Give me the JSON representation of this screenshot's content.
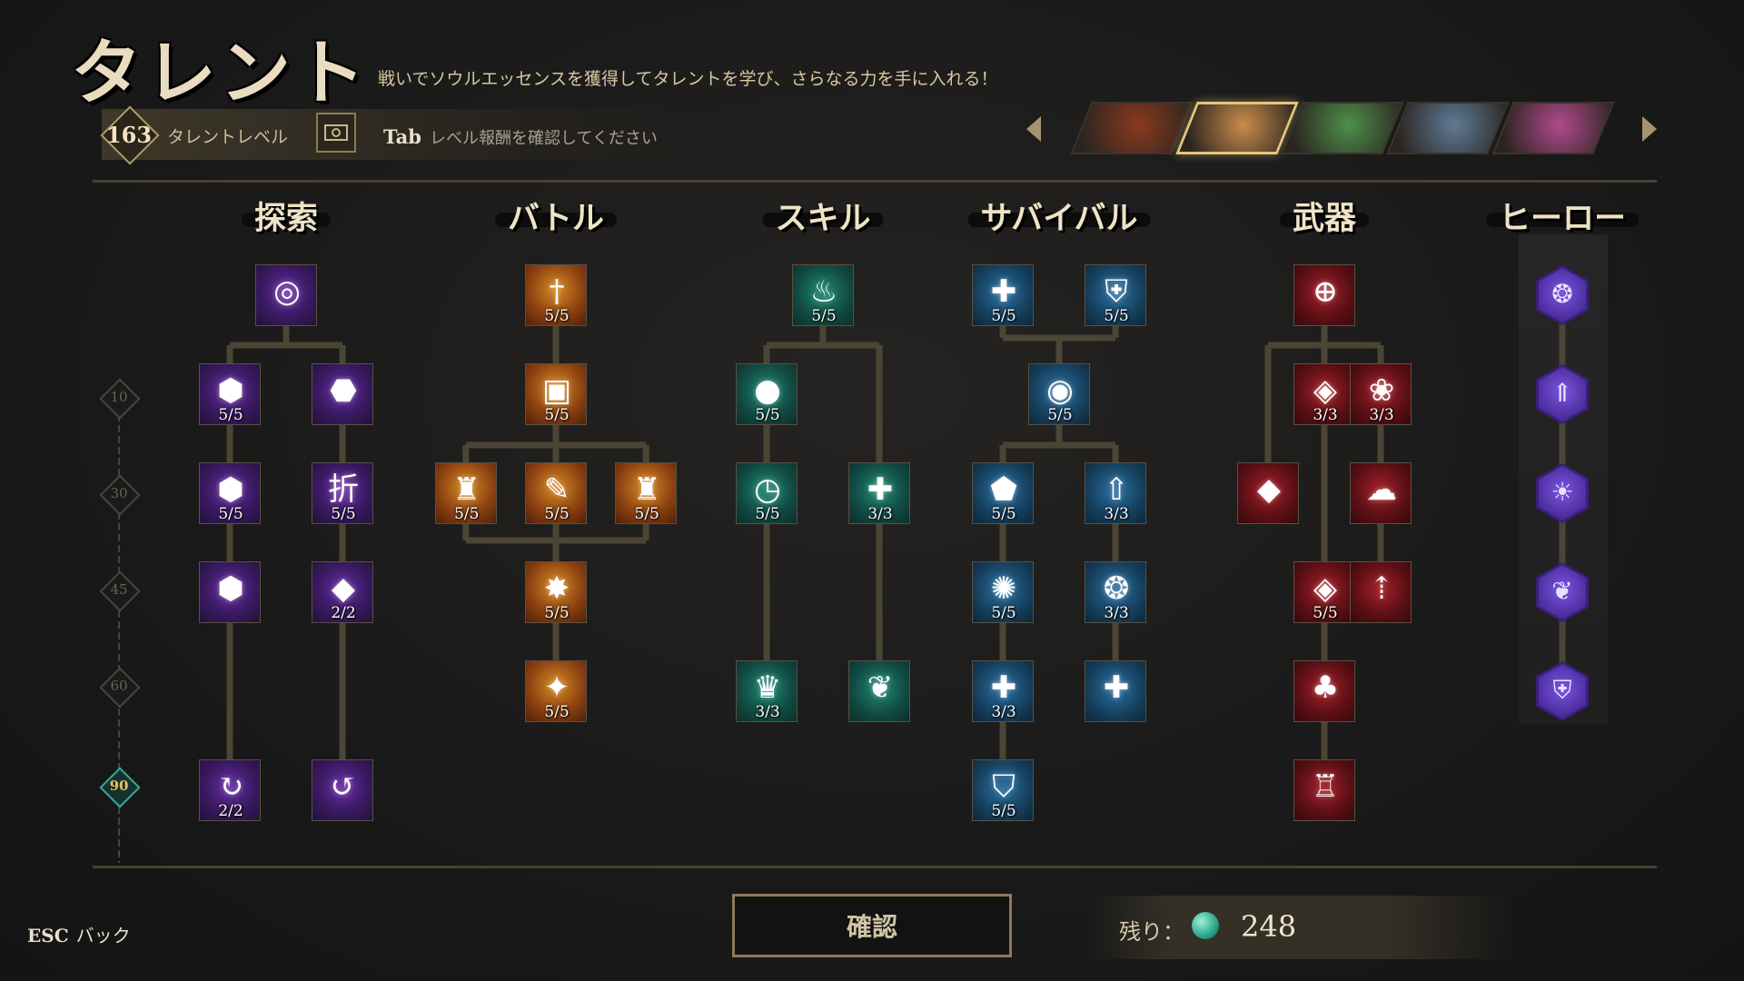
{
  "header": {
    "title": "タレント",
    "subtitle": "戦いでソウルエッセンスを獲得してタレントを学び、さらなる力を手に入れる！",
    "talent_level": "163",
    "talent_level_label": "タレントレベル",
    "tab_key": "Tab",
    "tab_hint": "レベル報酬を確認してください"
  },
  "heroes": [
    {
      "name": "hero-1",
      "color": "#8a3a1e"
    },
    {
      "name": "hero-2",
      "color": "#c98d4a",
      "selected": true
    },
    {
      "name": "hero-3",
      "color": "#4f8f4a"
    },
    {
      "name": "hero-4",
      "color": "#5f7b96"
    },
    {
      "name": "hero-5",
      "color": "#b04a8c"
    }
  ],
  "level_markers": [
    "10",
    "30",
    "45",
    "60",
    "90"
  ],
  "columns": [
    {
      "key": "explore",
      "title": "探索",
      "color": "purple",
      "nodes": [
        {
          "id": "e1",
          "col": 0,
          "row": 0,
          "icon": "swirl-icon",
          "glyph": "◎",
          "count": ""
        },
        {
          "id": "e2",
          "col": -1,
          "row": 1,
          "icon": "coin-icon",
          "glyph": "⬢",
          "count": "5/5"
        },
        {
          "id": "e3",
          "col": 1,
          "row": 1,
          "icon": "pouch-icon",
          "glyph": "⬣",
          "count": ""
        },
        {
          "id": "e4",
          "col": -1,
          "row": 2,
          "icon": "coins-icon",
          "glyph": "⬢",
          "count": "5/5"
        },
        {
          "id": "e5",
          "col": 1,
          "row": 2,
          "icon": "discount-icon",
          "glyph": "折",
          "count": "5/5"
        },
        {
          "id": "e6",
          "col": -1,
          "row": 3,
          "icon": "coin-glow-icon",
          "glyph": "⬢",
          "count": ""
        },
        {
          "id": "e7",
          "col": 1,
          "row": 3,
          "icon": "crystal-icon",
          "glyph": "◆",
          "count": "2/2"
        },
        {
          "id": "e8",
          "col": -1,
          "row": 5,
          "icon": "cycle-icon",
          "glyph": "↻",
          "count": "2/2"
        },
        {
          "id": "e9",
          "col": 1,
          "row": 5,
          "icon": "return-icon",
          "glyph": "↺",
          "count": ""
        }
      ]
    },
    {
      "key": "battle",
      "title": "バトル",
      "color": "orange",
      "nodes": [
        {
          "id": "b1",
          "col": 0,
          "row": 0,
          "icon": "sword-icon",
          "glyph": "†",
          "count": "5/5"
        },
        {
          "id": "b2",
          "col": 0,
          "row": 1,
          "icon": "chest-icon",
          "glyph": "▣",
          "count": "5/5"
        },
        {
          "id": "b3",
          "col": -1.6,
          "row": 2,
          "icon": "bullet-icon",
          "glyph": "♜",
          "count": "5/5"
        },
        {
          "id": "b4",
          "col": 0,
          "row": 2,
          "icon": "hammer-icon",
          "glyph": "✎",
          "count": "5/5"
        },
        {
          "id": "b5",
          "col": 1.6,
          "row": 2,
          "icon": "shell-icon",
          "glyph": "♜",
          "count": "5/5"
        },
        {
          "id": "b6",
          "col": 0,
          "row": 3,
          "icon": "explosion-icon",
          "glyph": "✸",
          "count": "5/5"
        },
        {
          "id": "b7",
          "col": 0,
          "row": 4,
          "icon": "star-icon",
          "glyph": "✦",
          "count": "5/5"
        }
      ]
    },
    {
      "key": "skill",
      "title": "スキル",
      "color": "green",
      "nodes": [
        {
          "id": "s1",
          "col": 0,
          "row": 0,
          "icon": "flame-icon",
          "glyph": "♨",
          "count": "5/5"
        },
        {
          "id": "s2",
          "col": -1,
          "row": 1,
          "icon": "potion-icon",
          "glyph": "●",
          "count": "5/5"
        },
        {
          "id": "s3",
          "col": -1,
          "row": 2,
          "icon": "clock-icon",
          "glyph": "◷",
          "count": "5/5"
        },
        {
          "id": "s4",
          "col": 1,
          "row": 2,
          "icon": "heal-cycle-icon",
          "glyph": "✚",
          "count": "3/3"
        },
        {
          "id": "s5",
          "col": -1,
          "row": 4,
          "icon": "bottle-icon",
          "glyph": "♛",
          "count": "3/3"
        },
        {
          "id": "s6",
          "col": 1,
          "row": 4,
          "icon": "leaf-icon",
          "glyph": "❦",
          "count": ""
        }
      ]
    },
    {
      "key": "survival",
      "title": "サバイバル",
      "color": "blue",
      "nodes": [
        {
          "id": "v1",
          "col": -1,
          "row": 0,
          "icon": "heal-plus-icon",
          "glyph": "✚",
          "count": "5/5"
        },
        {
          "id": "v2",
          "col": 1,
          "row": 0,
          "icon": "armor-icon",
          "glyph": "⛨",
          "count": "5/5"
        },
        {
          "id": "v3",
          "col": 0,
          "row": 1,
          "icon": "orb-icon",
          "glyph": "◉",
          "count": "5/5"
        },
        {
          "id": "v4",
          "col": -1,
          "row": 2,
          "icon": "shield-icon",
          "glyph": "⬟",
          "count": "5/5"
        },
        {
          "id": "v5",
          "col": 1,
          "row": 2,
          "icon": "arrow-up-icon",
          "glyph": "⇧",
          "count": "3/3"
        },
        {
          "id": "v6",
          "col": -1,
          "row": 3,
          "icon": "vortex-icon",
          "glyph": "✺",
          "count": "5/5"
        },
        {
          "id": "v7",
          "col": 1,
          "row": 3,
          "icon": "spiral-icon",
          "glyph": "❂",
          "count": "3/3"
        },
        {
          "id": "v8",
          "col": -1,
          "row": 4,
          "icon": "heal-circle-icon",
          "glyph": "✚",
          "count": "3/3"
        },
        {
          "id": "v9",
          "col": 1,
          "row": 4,
          "icon": "heal-beam-icon",
          "glyph": "✚",
          "count": ""
        },
        {
          "id": "v10",
          "col": -1,
          "row": 5,
          "icon": "guard-icon",
          "glyph": "⛉",
          "count": "5/5"
        }
      ]
    },
    {
      "key": "weapon",
      "title": "武器",
      "color": "red",
      "nodes": [
        {
          "id": "w1",
          "col": 0,
          "row": 0,
          "icon": "crosshair-icon",
          "glyph": "⊕",
          "count": ""
        },
        {
          "id": "w2",
          "col": 0,
          "row": 1,
          "icon": "fang-icon",
          "glyph": "◈",
          "count": "3/3"
        },
        {
          "id": "w3",
          "col": 1,
          "row": 1,
          "icon": "beast-icon",
          "glyph": "❀",
          "count": "3/3"
        },
        {
          "id": "w4",
          "col": -1,
          "row": 2,
          "icon": "diamond-icon",
          "glyph": "◆",
          "count": ""
        },
        {
          "id": "w5",
          "col": 1,
          "row": 2,
          "icon": "cloud-icon",
          "glyph": "☁",
          "count": ""
        },
        {
          "id": "w6",
          "col": 0,
          "row": 3,
          "icon": "gem-icon",
          "glyph": "◈",
          "count": "5/5"
        },
        {
          "id": "w7",
          "col": 1,
          "row": 3,
          "icon": "scroll-up-icon",
          "glyph": "⇡",
          "count": ""
        },
        {
          "id": "w8",
          "col": 0,
          "row": 4,
          "icon": "anvil-icon",
          "glyph": "♣",
          "count": ""
        },
        {
          "id": "w9",
          "col": 0,
          "row": 5,
          "icon": "forge-icon",
          "glyph": "♖",
          "count": ""
        }
      ]
    },
    {
      "key": "hero",
      "title": "ヒーロー",
      "color": "hex",
      "nodes": [
        {
          "id": "h1",
          "row": 0,
          "icon": "spirit-icon",
          "glyph": "❂"
        },
        {
          "id": "h2",
          "row": 1,
          "icon": "rank-up-icon",
          "glyph": "⇑"
        },
        {
          "id": "h3",
          "row": 2,
          "icon": "rise-icon",
          "glyph": "☀"
        },
        {
          "id": "h4",
          "row": 3,
          "icon": "wing-icon",
          "glyph": "❦"
        },
        {
          "id": "h5",
          "row": 4,
          "icon": "shield-hex-icon",
          "glyph": "⛨"
        }
      ]
    }
  ],
  "footer": {
    "esc_key": "ESC",
    "esc_label": "バック",
    "confirm_label": "確認",
    "remaining_label": "残り：",
    "remaining_value": "248"
  },
  "colors": {
    "accent": "#e6c57a",
    "line": "#4b4534"
  }
}
